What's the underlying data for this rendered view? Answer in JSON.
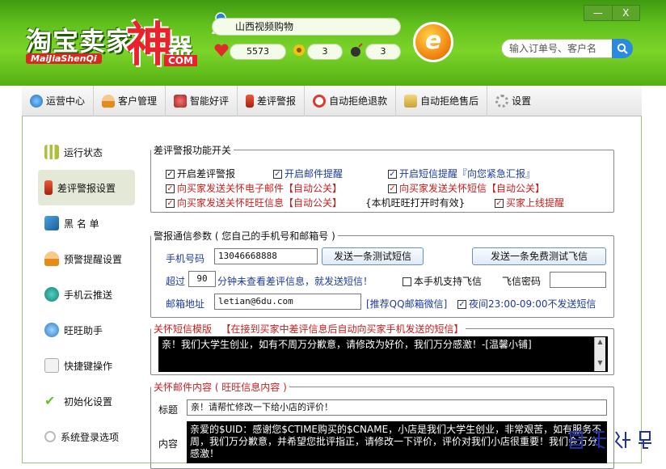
{
  "header": {
    "logo_main": "淘宝卖家",
    "logo_shen": "神",
    "logo_qi": "器",
    "logo_pinyin": "MaiJiaShenQi",
    "logo_com": "COM",
    "shop_name": "山西视频购物",
    "count_heart": "5573",
    "count_flower": "3",
    "count_bomb": "3",
    "ie_label": "e",
    "search_placeholder": "输入订单号、客户名",
    "win_minimize": "—",
    "win_close": "X"
  },
  "tabs": [
    {
      "label": "运营中心",
      "icon": "globe-icon"
    },
    {
      "label": "客户管理",
      "icon": "user-icon"
    },
    {
      "label": "智能好评",
      "icon": "satellite-icon"
    },
    {
      "label": "差评警报",
      "icon": "alarm-icon"
    },
    {
      "label": "自动拒绝退款",
      "icon": "power-icon"
    },
    {
      "label": "自动拒绝售后",
      "icon": "cocktail-icon"
    },
    {
      "label": "设置",
      "icon": "gear-icon"
    }
  ],
  "sidebar": [
    {
      "label": "运行状态",
      "icon": "bar-chart-icon"
    },
    {
      "label": "差评警报设置",
      "icon": "alarm-icon"
    },
    {
      "label": "黑 名 单",
      "icon": "blacklist-icon"
    },
    {
      "label": "预警提醒设置",
      "icon": "user-alert-icon"
    },
    {
      "label": "手机云推送",
      "icon": "cloud-push-icon"
    },
    {
      "label": "旺旺助手",
      "icon": "wangwang-icon"
    },
    {
      "label": "快捷键操作",
      "icon": "shortcut-icon"
    },
    {
      "label": "初始化设置",
      "icon": "check-icon"
    },
    {
      "label": "系统登录选项",
      "icon": "login-icon"
    }
  ],
  "sidebar_active": 1,
  "switches": {
    "legend": "差评警报功能开关",
    "items": [
      {
        "label": "开启差评警报",
        "checked": true
      },
      {
        "label": "开启邮件提醒",
        "checked": true
      },
      {
        "label": "开启短信提醒『向您紧急汇报』",
        "checked": true
      },
      {
        "label": "向买家发送关怀电子邮件【自动公关】",
        "checked": true
      },
      {
        "label": "向买家发送关怀短信【自动公关】",
        "checked": true
      },
      {
        "label": "向买家发送关怀旺旺信息【自动公关】",
        "checked": true
      },
      {
        "label": "{本机旺旺打开时有效}",
        "checked": false
      },
      {
        "label": "买家上线提醒",
        "checked": true
      }
    ]
  },
  "contact": {
    "legend": "警报通信参数 ( 您自己的手机号和邮箱号 )",
    "phone_label": "手机号码",
    "phone_value": "13046668888",
    "send_sms_button": "发送一条测试短信",
    "send_fetion_button": "发送一条免费测试飞信",
    "timeout_prefix": "超过",
    "timeout_value": "90",
    "timeout_suffix": "分钟未查看差评信息，就发送短信！",
    "fetion_support_label": "本手机支持飞信",
    "fetion_support_checked": false,
    "fetion_password_label": "飞信密码",
    "fetion_password_value": "",
    "email_label": "邮箱地址",
    "email_value": "letian@6du.com",
    "qq_recommend": "[推荐QQ邮箱微信]",
    "night_label": "夜间23:00-09:00不发送短信",
    "night_checked": true
  },
  "sms_template": {
    "legend_a": "关怀短信模版",
    "legend_b": "【在接到买家中差评信息后自动向买家手机发送的短信】",
    "text": "亲！我们大学生创业，如有不周万分歉意，请修改为好价，我们万分感激！-[温馨小铺]"
  },
  "mail": {
    "legend": "关怀邮件内容 ( 旺旺信息内容 )",
    "title_label": "标题",
    "title_value": "亲！请帮忙修改一下给小店的评价！",
    "content_label": "内容",
    "content_text": "亲爱的$UID：感谢您$CTIME购买的$CNAME，小店是我们大学生创业，非常艰苦，如有服务不周，我们万分歉意，并希望您批评指正，请修改一下评价，评价对我们小店很重要！我们会万分感激！"
  },
  "watermark": "最需教育",
  "colors": {
    "header_green": "#63c21e",
    "alert_red": "#c5201f",
    "label_blue": "#1c3c9a"
  }
}
